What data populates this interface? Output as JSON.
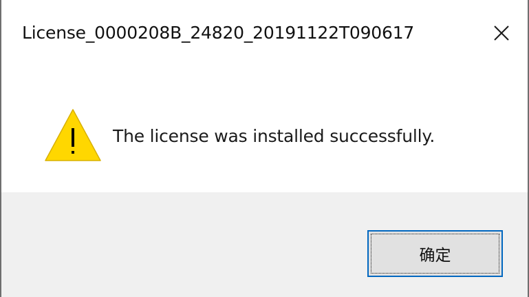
{
  "window": {
    "title": "License_0000208B_24820_20191122T090617",
    "close_icon": "close-icon"
  },
  "content": {
    "icon": "warning-icon",
    "message": "The license was installed successfully."
  },
  "footer": {
    "ok_label": "确定"
  },
  "colors": {
    "warning_fill": "#ffd700",
    "warning_mark": "#000000",
    "button_border": "#0067c0",
    "button_fill": "#e1e1e1",
    "footer_bg": "#f0f0f0"
  }
}
